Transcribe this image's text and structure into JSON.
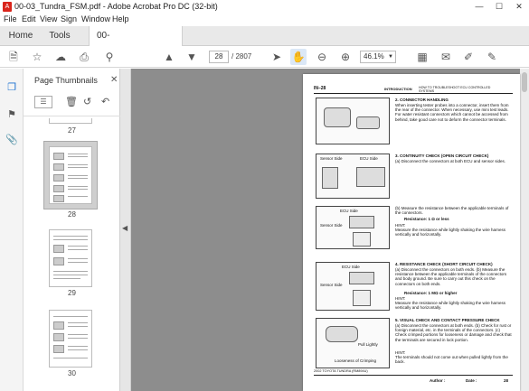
{
  "window": {
    "title": "00-03_Tundra_FSM.pdf - Adobe Acrobat Pro DC (32-bit)",
    "app_icon": "acrobat-icon"
  },
  "menu": [
    "File",
    "Edit",
    "View",
    "Sign",
    "Window",
    "Help"
  ],
  "tabs": {
    "home": "Home",
    "tools": "Tools",
    "document": "00-03_Tundra_FSM..."
  },
  "toolbar": {
    "page_current": "28",
    "page_total": "/ 2807",
    "zoom": "46.1%"
  },
  "panel": {
    "title": "Page Thumbnails",
    "thumbnails": [
      {
        "label": "27"
      },
      {
        "label": "28"
      },
      {
        "label": "29"
      },
      {
        "label": "30"
      }
    ]
  },
  "doc": {
    "header_left": "IN–28",
    "header_mid": "INTRODUCTION",
    "header_right": "HOW TO TROUBLESHOOT ECU CONTROLLED SYSTEMS",
    "sections": [
      {
        "heading": "2.    CONNECTOR HANDLING",
        "body": "When inserting tester probes into a connector, insert them from the rear of the connector. When necessary, use mini test leads. For water resistant connectors which cannot be accessed from behind, take good care not to deform the connector terminals."
      },
      {
        "heading": "3.    CONTINUITY CHECK (OPEN CIRCUIT CHECK)",
        "body": "(a)   Disconnect the connectors at both ECU and sensor sides."
      },
      {
        "heading": "",
        "body": "(b)   Measure the resistance between the applicable terminals of the connectors.",
        "spec": "Resistance: 1 Ω or less",
        "hint": "HINT:",
        "hint_body": "Measure the resistance while lightly shaking the wire harness vertically and horizontally."
      },
      {
        "heading": "4.    RESISTANCE CHECK (SHORT CIRCUIT CHECK)",
        "body": "(a)   Disconnect the connectors on both ends.  (b)   Measure the resistance between the applicable terminals of the connectors and body ground. Be sure to carry out this check on the connectors on both ends.",
        "spec": "Resistance: 1 MΩ or higher",
        "hint": "HINT:",
        "hint_body": "Measure the resistance while lightly shaking the wire harness vertically and horizontally."
      },
      {
        "heading": "5.    VISUAL CHECK AND CONTACT PRESSURE CHECK",
        "body": "(a)   Disconnect the connectors at both ends.  (b)   Check for rust or foreign material, etc. in the terminals of the connectors.  (c)   Check crimped portions for looseness or damage and check that the terminals are secured in lock portion.",
        "hint": "HINT:",
        "hint_body": "The terminals should not come out when pulled lightly from the back."
      }
    ],
    "fig_labels": {
      "sensor_side": "Sensor Side",
      "ecu_side": "ECU Side",
      "pull_lightly": "Pull Lightly",
      "looseness": "Looseness of Crimping"
    },
    "footer_left": "2002 TOYOTA TUNDRA  (RM894U)",
    "footer_author": "Author :",
    "footer_date": "Date :",
    "footer_page": "28"
  }
}
